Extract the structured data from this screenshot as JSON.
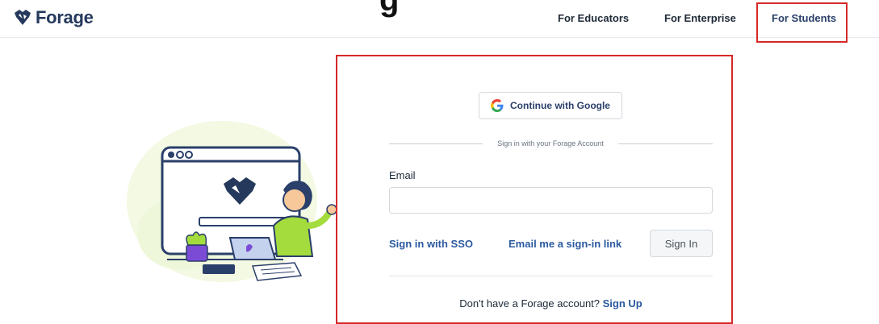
{
  "header": {
    "logo_text": "Forage",
    "nav": {
      "educators": "For Educators",
      "enterprise": "For Enterprise",
      "students": "For Students"
    }
  },
  "login": {
    "google_button": "Continue with Google",
    "divider_text": "Sign in with your Forage Account",
    "email_label": "Email",
    "email_value": "",
    "sso_link": "Sign in with SSO",
    "magic_link": "Email me a sign-in link",
    "signin_button": "Sign In",
    "signup_prompt": "Don't have a Forage account?",
    "signup_link": "Sign Up"
  },
  "colors": {
    "brand_navy": "#25395c",
    "link_blue": "#2c5aa0",
    "highlight_red": "#d62828",
    "illustration_green": "#a3dc3c",
    "illustration_purple": "#7b4bd6"
  },
  "icons": [
    "forage-logo-icon",
    "google-g-icon",
    "browser-window-icon",
    "forage-heart-icon",
    "laptop-icon",
    "plant-icon",
    "book-icon"
  ]
}
